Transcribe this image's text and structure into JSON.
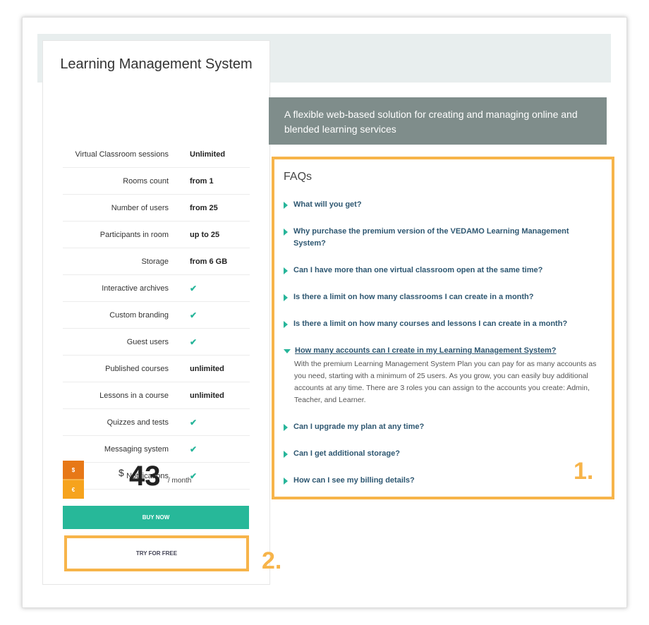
{
  "plan": {
    "title": "Learning Management System",
    "features": [
      {
        "label": "Virtual Classroom sessions",
        "value": "Unlimited"
      },
      {
        "label": "Rooms count",
        "value": "from 1"
      },
      {
        "label": "Number of users",
        "value": "from 25"
      },
      {
        "label": "Participants in room",
        "value": "up to 25"
      },
      {
        "label": "Storage",
        "value": "from 6 GB"
      },
      {
        "label": "Interactive archives",
        "value": "check-icon"
      },
      {
        "label": "Custom branding",
        "value": "check-icon"
      },
      {
        "label": "Guest users",
        "value": "check-icon"
      },
      {
        "label": "Published courses",
        "value": "unlimited"
      },
      {
        "label": "Lessons in a course",
        "value": "unlimited"
      },
      {
        "label": "Quizzes and tests",
        "value": "check-icon"
      },
      {
        "label": "Messaging system",
        "value": "check-icon"
      },
      {
        "label": "Notifications",
        "value": "check-icon"
      }
    ],
    "currency": {
      "usd": "$",
      "eur": "€",
      "selected": "usd"
    },
    "price": {
      "symbol": "$",
      "amount": "43",
      "period": "/ month"
    },
    "buy_label": "BUY NOW",
    "try_label": "TRY FOR FREE"
  },
  "banner": {
    "text": "A flexible web-based solution for creating and managing online and blended learning services"
  },
  "faq": {
    "title": "FAQs",
    "items": [
      {
        "q": "What will you get?",
        "open": false
      },
      {
        "q": "Why purchase the premium version of the VEDAMO Learning Management System?",
        "open": false
      },
      {
        "q": "Can I have more than one virtual classroom open at the same time?",
        "open": false
      },
      {
        "q": "Is there a limit on how many classrooms I can create in a month?",
        "open": false
      },
      {
        "q": "Is there a limit on how many courses and lessons I can create in a month?",
        "open": false
      },
      {
        "q": "How many accounts can I create in my Learning Management System?",
        "open": true,
        "a": "With the premium Learning Management System Plan you can pay for as many accounts as you need, starting with a minimum of 25 users. As you grow, you can easily buy additional accounts at any time. There are 3 roles you can assign to the accounts you create: Admin, Teacher, and Learner."
      },
      {
        "q": "Can I upgrade my plan at any time?",
        "open": false
      },
      {
        "q": "Can I get additional storage?",
        "open": false
      },
      {
        "q": "How can I see my billing details?",
        "open": false
      }
    ]
  },
  "annotations": {
    "marker_1": "1.",
    "marker_2": "2."
  },
  "colors": {
    "accent_green": "#27b899",
    "highlight_orange": "#f7b44a",
    "banner_grey": "#7f8d8b",
    "faq_link": "#2e5771"
  }
}
